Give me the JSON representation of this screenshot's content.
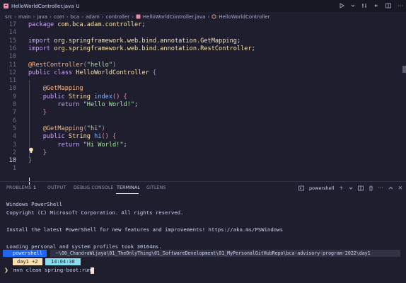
{
  "tab": {
    "title": "HelloWorldController.java",
    "modified": "U"
  },
  "breadcrumb": [
    "src",
    "main",
    "java",
    "com",
    "bca",
    "adam",
    "controller",
    "HelloWorldController.java",
    "HelloWorldController"
  ],
  "editor": {
    "lines": [
      {
        "n": "17",
        "toks": [
          [
            "k",
            "package "
          ],
          [
            "pk",
            "com.bca.adam.controller"
          ],
          [
            "pl",
            ";"
          ]
        ]
      },
      {
        "n": "14",
        "toks": []
      },
      {
        "n": "15",
        "toks": [
          [
            "k",
            "import "
          ],
          [
            "pk",
            "org.springframework.web.bind.annotation."
          ],
          [
            "ty",
            "GetMapping"
          ],
          [
            "pl",
            ";"
          ]
        ]
      },
      {
        "n": "16",
        "toks": [
          [
            "k",
            "import "
          ],
          [
            "pk",
            "org.springframework.web.bind.annotation."
          ],
          [
            "ty",
            "RestController"
          ],
          [
            "pl",
            ";"
          ]
        ]
      },
      {
        "n": "10",
        "toks": []
      },
      {
        "n": "11",
        "toks": [
          [
            "an",
            "@RestController"
          ],
          [
            "pn",
            "("
          ],
          [
            "st",
            "\"hello\""
          ],
          [
            "pn",
            ")"
          ]
        ]
      },
      {
        "n": "12",
        "toks": [
          [
            "k",
            "public class "
          ],
          [
            "ty",
            "HelloWorldController "
          ],
          [
            "pn",
            "{"
          ]
        ]
      },
      {
        "n": "11",
        "toks": []
      },
      {
        "n": "10",
        "toks": [
          [
            "an",
            "    @GetMapping"
          ]
        ]
      },
      {
        "n": "9",
        "toks": [
          [
            "k",
            "    public "
          ],
          [
            "ty",
            "String "
          ],
          [
            "fn",
            "index"
          ],
          [
            "br",
            "() {"
          ]
        ]
      },
      {
        "n": "8",
        "toks": [
          [
            "k",
            "        return "
          ],
          [
            "st",
            "\"Hello World!\""
          ],
          [
            "pl",
            ";"
          ]
        ]
      },
      {
        "n": "7",
        "toks": [
          [
            "br",
            "    }"
          ]
        ]
      },
      {
        "n": "6",
        "toks": []
      },
      {
        "n": "5",
        "toks": [
          [
            "an",
            "    @GetMapping"
          ],
          [
            "pn",
            "("
          ],
          [
            "st",
            "\"hi\""
          ],
          [
            "pn",
            ")"
          ]
        ]
      },
      {
        "n": "4",
        "toks": [
          [
            "k",
            "    public "
          ],
          [
            "ty",
            "String "
          ],
          [
            "fn",
            "hi"
          ],
          [
            "br",
            "() {"
          ]
        ]
      },
      {
        "n": "3",
        "toks": [
          [
            "k",
            "        return "
          ],
          [
            "st",
            "\"Hi World!\""
          ],
          [
            "pl",
            ";"
          ]
        ]
      },
      {
        "n": "2",
        "toks": [
          [
            "br",
            "    }"
          ]
        ]
      },
      {
        "n": "18",
        "toks": [
          [
            "pn",
            "}"
          ]
        ]
      },
      {
        "n": "1",
        "toks": []
      }
    ]
  },
  "panel": {
    "tabs": [
      "PROBLEMS",
      "OUTPUT",
      "DEBUG CONSOLE",
      "TERMINAL",
      "GITLENS"
    ],
    "problems_count": "1",
    "active_tab": "TERMINAL",
    "shell_label": "powershell"
  },
  "terminal": {
    "lines": [
      "Windows PowerShell",
      "Copyright (C) Microsoft Corporation. All rights reserved.",
      "",
      "Install the latest PowerShell for new features and improvements! https://aka.ms/PSWindows",
      "",
      "Loading personal and system profiles took 30164ms."
    ],
    "prompt_shell": "powershell",
    "prompt_path": "~\\00_ChandraWijaya\\01_TheOnlyThing\\01_SoftwareDevelopment\\01_MyPersonalGitHubRepo\\bca-advisory-program-2022\\day1",
    "branch": "day1 +2",
    "time": "14:04:38",
    "command": "mvn clean spring-boot:run"
  }
}
